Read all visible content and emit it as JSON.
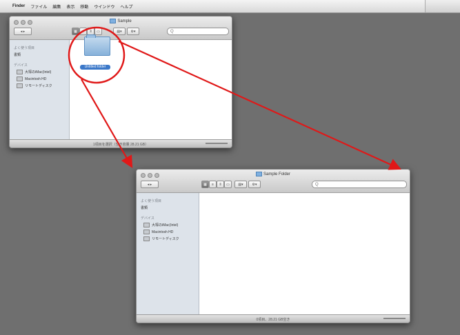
{
  "menubar": {
    "apple": "",
    "items": [
      "Finder",
      "ファイル",
      "編集",
      "表示",
      "移動",
      "ウインドウ",
      "ヘルプ"
    ]
  },
  "window1": {
    "title": "Sample",
    "sidebar": {
      "section_favorites": "よく使う項目",
      "favorite_item": "書類",
      "section_devices": "デバイス",
      "devices": [
        "大塚のiMac(Intel)",
        "Macintosh HD",
        "リモートディスク"
      ]
    },
    "folder_label": "Untitled folder",
    "status": "1項目を選択（空き容量 28.21 GB）",
    "search_placeholder": "Q"
  },
  "window2": {
    "title": "Sample Folder",
    "sidebar": {
      "section_favorites": "よく使う項目",
      "favorite_item": "書類",
      "section_devices": "デバイス",
      "devices": [
        "大塚のiMac(Intel)",
        "Macintosh HD",
        "リモートディスク"
      ]
    },
    "status": "0項目、28.21 GB空き",
    "search_placeholder": "Q"
  },
  "annotation": {
    "arrow_color": "#e01818",
    "circle_color": "#e01818"
  }
}
